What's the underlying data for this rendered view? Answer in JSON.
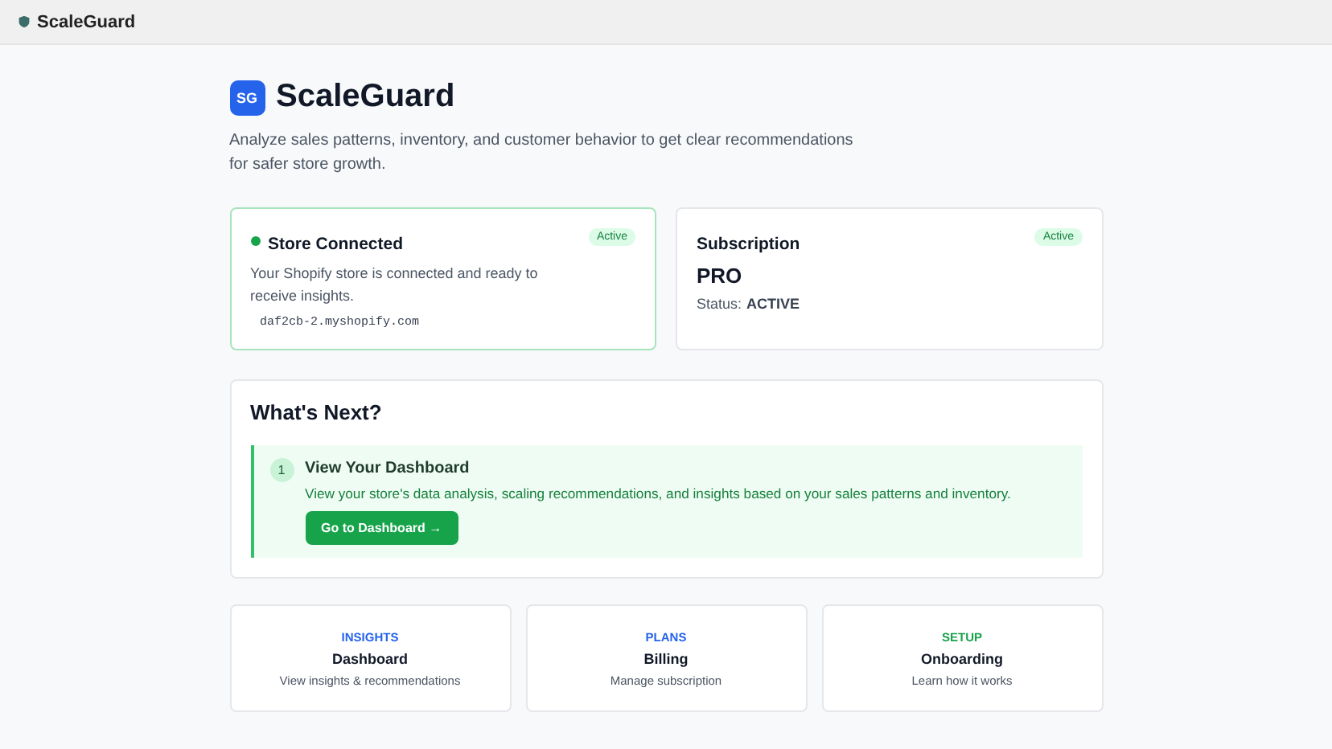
{
  "topbar": {
    "app_name": "ScaleGuard"
  },
  "header": {
    "logo": "SG",
    "title": "ScaleGuard",
    "subtitle": "Analyze sales patterns, inventory, and customer behavior to get clear recommendations for safer store growth."
  },
  "store_card": {
    "title": "Store Connected",
    "connected": true,
    "badge": "Active",
    "text": "Your Shopify store is connected and ready to receive insights.",
    "domain": "daf2cb-2.myshopify.com"
  },
  "subscription_card": {
    "title": "Subscription",
    "badge": "Active",
    "plan": "PRO",
    "status_label": "Status:",
    "status": "ACTIVE"
  },
  "next": {
    "title": "What's Next?",
    "steps": [
      {
        "number": "1",
        "title": "View Your Dashboard",
        "text": "View your store's data analysis, scaling recommendations, and insights based on your sales patterns and inventory.",
        "button": "Go to Dashboard →"
      }
    ]
  },
  "links": [
    {
      "category": "INSIGHTS",
      "color": "#2563eb",
      "title": "Dashboard",
      "text": "View insights & recommendations"
    },
    {
      "category": "PLANS",
      "color": "#2563eb",
      "title": "Billing",
      "text": "Manage subscription"
    },
    {
      "category": "SETUP",
      "color": "#16a34a",
      "title": "Onboarding",
      "text": "Learn how it works"
    }
  ]
}
